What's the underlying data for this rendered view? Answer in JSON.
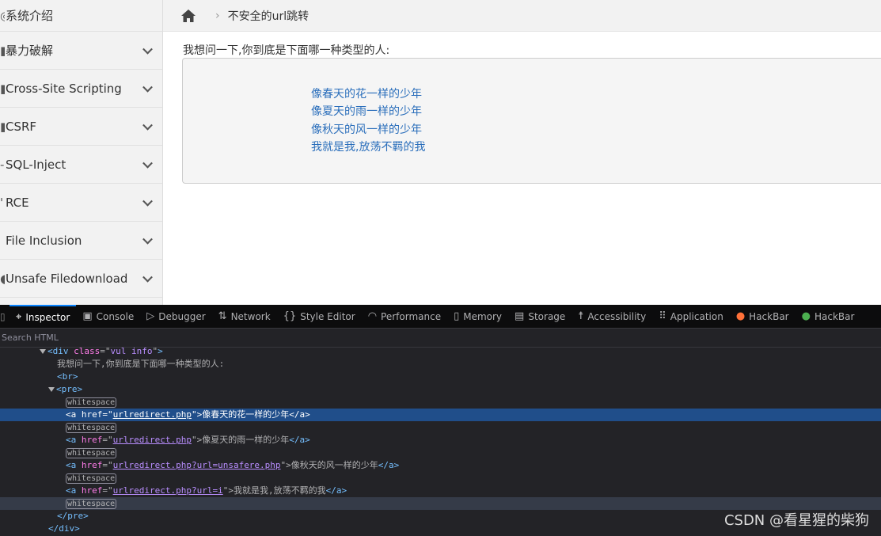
{
  "sidebar": {
    "items": [
      {
        "label": "系统介绍",
        "icon": "info-icon",
        "expandable": false
      },
      {
        "label": "暴力破解",
        "icon": "key-icon",
        "expandable": true
      },
      {
        "label": "Cross-Site Scripting",
        "icon": "code-icon",
        "expandable": true
      },
      {
        "label": "CSRF",
        "icon": "link-icon",
        "expandable": true
      },
      {
        "label": "SQL-Inject",
        "icon": "database-icon",
        "expandable": true
      },
      {
        "label": "RCE",
        "icon": "terminal-icon",
        "expandable": true
      },
      {
        "label": "File Inclusion",
        "icon": "file-icon",
        "expandable": true
      },
      {
        "label": "Unsafe Filedownload",
        "icon": "download-icon",
        "expandable": true
      }
    ]
  },
  "breadcrumb": {
    "current": "不安全的url跳转"
  },
  "main": {
    "question": "我想问一下,你到底是下面哪一种类型的人:",
    "links": [
      "像春天的花一样的少年",
      "像夏天的雨一样的少年",
      "像秋天的风一样的少年",
      "我就是我,放荡不羁的我"
    ],
    "link_color": "#2a6ebb"
  },
  "devtools": {
    "tabs": [
      {
        "label": "Inspector",
        "icon": "inspector-icon",
        "active": true
      },
      {
        "label": "Console",
        "icon": "console-icon"
      },
      {
        "label": "Debugger",
        "icon": "debugger-icon"
      },
      {
        "label": "Network",
        "icon": "network-icon"
      },
      {
        "label": "Style Editor",
        "icon": "braces-icon"
      },
      {
        "label": "Performance",
        "icon": "gauge-icon"
      },
      {
        "label": "Memory",
        "icon": "chip-icon"
      },
      {
        "label": "Storage",
        "icon": "storage-icon"
      },
      {
        "label": "Accessibility",
        "icon": "accessibility-icon"
      },
      {
        "label": "Application",
        "icon": "grid-icon"
      },
      {
        "label": "HackBar",
        "icon": "firefox-icon"
      },
      {
        "label": "HackBar",
        "icon": "hackbar-icon"
      }
    ],
    "search_placeholder": "Search HTML",
    "tree": {
      "div_open_tag": "div",
      "div_class_attr": "class",
      "div_class": "vul info",
      "text": "我想问一下,你到底是下面哪一种类型的人:",
      "br": "<br>",
      "pre": "pre",
      "whitespace": "whitespace",
      "anchors": [
        {
          "href": "urlredirect.php",
          "text": "像春天的花一样的少年"
        },
        {
          "href": "urlredirect.php",
          "text": "像夏天的雨一样的少年"
        },
        {
          "href": "urlredirect.php?url=unsafere.php",
          "text": "像秋天的风一样的少年"
        },
        {
          "href": "urlredirect.php?url=i",
          "text": "我就是我,放荡不羁的我"
        }
      ]
    }
  },
  "watermark": "CSDN @看星猩的柴狗"
}
